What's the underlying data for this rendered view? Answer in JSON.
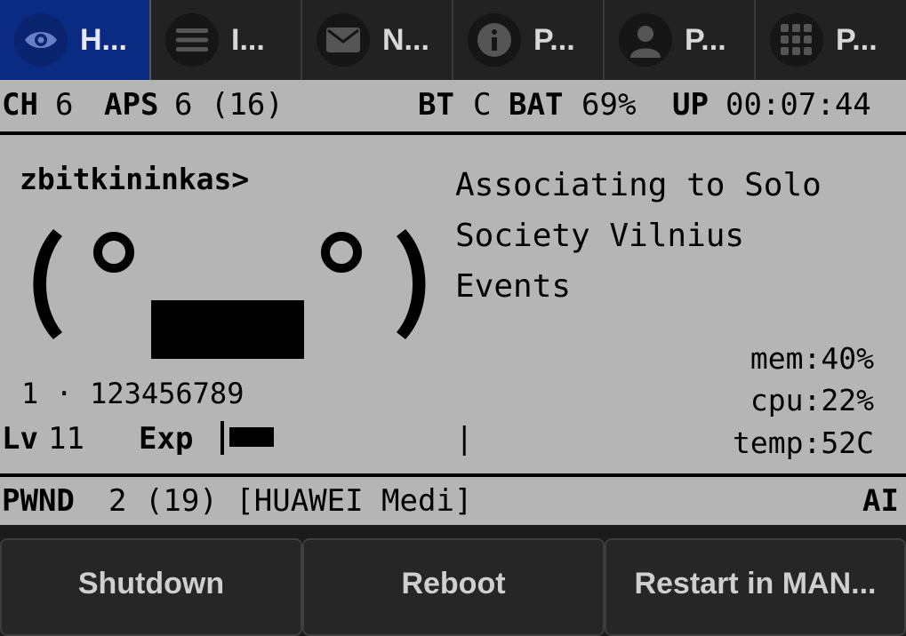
{
  "tabs": [
    {
      "label": "H...",
      "icon": "eye-icon",
      "active": true
    },
    {
      "label": "I...",
      "icon": "menu-icon"
    },
    {
      "label": "N...",
      "icon": "mail-icon"
    },
    {
      "label": "P...",
      "icon": "info-icon"
    },
    {
      "label": "P...",
      "icon": "person-icon"
    },
    {
      "label": "P...",
      "icon": "grid-icon"
    }
  ],
  "status": {
    "ch_label": "CH",
    "ch_value": "6",
    "aps_label": "APS",
    "aps_value": "6 (16)",
    "bt_label": "BT",
    "bt_value": "C",
    "bat_label": "BAT",
    "bat_value": "69%",
    "up_label": "UP",
    "up_value": "00:07:44"
  },
  "main": {
    "name": "zbitkininkas>",
    "message_lines": [
      "Associating to Solo",
      "Society Vilnius",
      "Events"
    ],
    "face": "( °▃▃° )",
    "channels": "1 · 123456789",
    "level_label": "Lv",
    "level_value": "11",
    "exp_label": "Exp",
    "exp_progress": 0.18,
    "mem": "mem:40%",
    "cpu": "cpu:22%",
    "temp": "temp:52C",
    "cursor": "|"
  },
  "footer": {
    "pwnd_label": "PWND",
    "pwnd_value": "2 (19) [HUAWEI Medi]",
    "mode": "AI"
  },
  "buttons": {
    "shutdown": "Shutdown",
    "reboot": "Reboot",
    "restart": "Restart in MAN..."
  },
  "colors": {
    "active_tab": "#0b2a82",
    "screen_bg": "#b5b5b5"
  }
}
